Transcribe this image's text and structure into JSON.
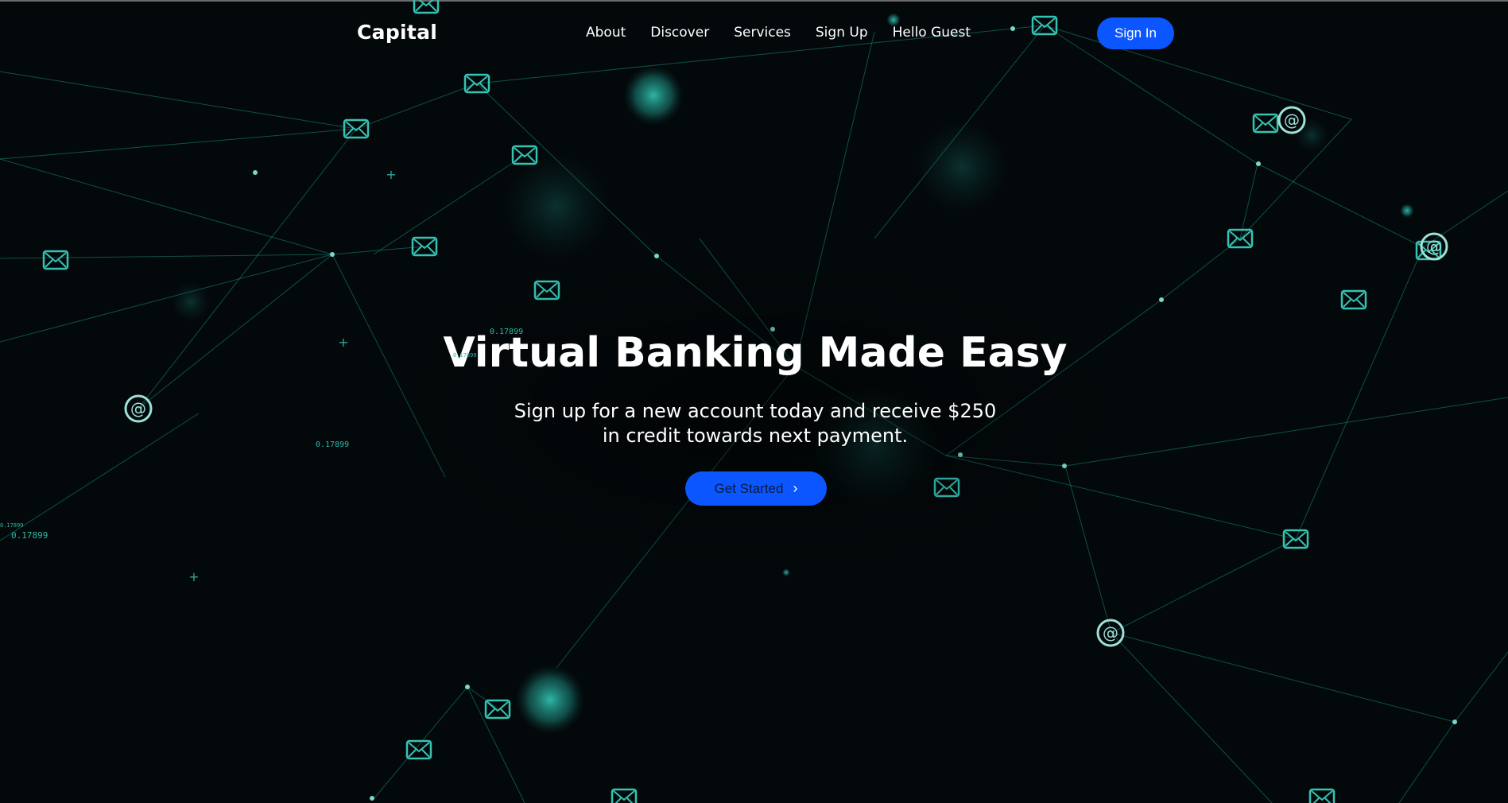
{
  "brand": {
    "name": "Capital"
  },
  "nav": {
    "items": [
      {
        "label": "About"
      },
      {
        "label": "Discover"
      },
      {
        "label": "Services"
      },
      {
        "label": "Sign Up"
      },
      {
        "label": "Hello Guest"
      }
    ],
    "signin_label": "Sign In"
  },
  "hero": {
    "title": "Virtual Banking Made Easy",
    "subtitle_line1": "Sign up for a new account today and receive $250",
    "subtitle_line2": "in credit towards next payment.",
    "cta_label": "Get Started",
    "cta_icon": "chevron-right-icon"
  },
  "background": {
    "floating_numbers": [
      "0.17899",
      "0.17899",
      "0.17899",
      "0.17899",
      "0.17899"
    ],
    "node_icons": [
      "mail-icon",
      "at-icon",
      "plus-icon"
    ]
  },
  "colors": {
    "page_background": "#03080a",
    "network_lines": "#1fa89a",
    "accent_blue": "#0b56ff",
    "text": "#ffffff"
  }
}
